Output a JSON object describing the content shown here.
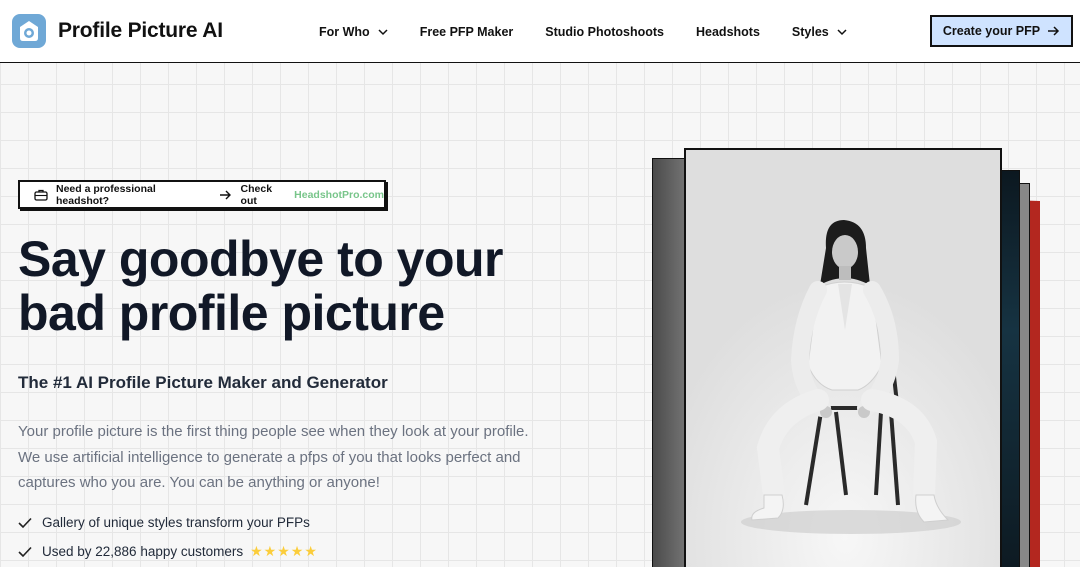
{
  "nav": {
    "brand": "Profile Picture AI",
    "links": [
      {
        "label": "For Who",
        "has_dropdown": true
      },
      {
        "label": "Free PFP Maker",
        "has_dropdown": false
      },
      {
        "label": "Studio Photoshoots",
        "has_dropdown": false
      },
      {
        "label": "Headshots",
        "has_dropdown": false
      },
      {
        "label": "Styles",
        "has_dropdown": true
      }
    ],
    "cta_label": "Create your PFP",
    "cta_icon": "arrow-right-icon"
  },
  "badge": {
    "prompt": "Need a professional headshot?",
    "check_out": "Check out",
    "link_text": "HeadshotPro.com",
    "link_color": "#78c58a"
  },
  "hero": {
    "title_line1": "Say goodbye to your",
    "title_line2": "bad profile picture",
    "subtitle": "The #1 AI Profile Picture Maker and Generator",
    "description": "Your profile picture is the first thing people see when they look at your profile. We use artificial intelligence to generate a pfps of you that looks perfect and captures who you are. You can be anything or anyone!",
    "features": [
      {
        "text": "Gallery of unique styles transform your PFPs"
      },
      {
        "text": "Used by 22,886 happy customers",
        "stars": "★★★★★"
      }
    ]
  },
  "colors": {
    "accent_button": "#cfe3ff",
    "star": "#fbcd3b",
    "logo": "#6fa8d6"
  }
}
